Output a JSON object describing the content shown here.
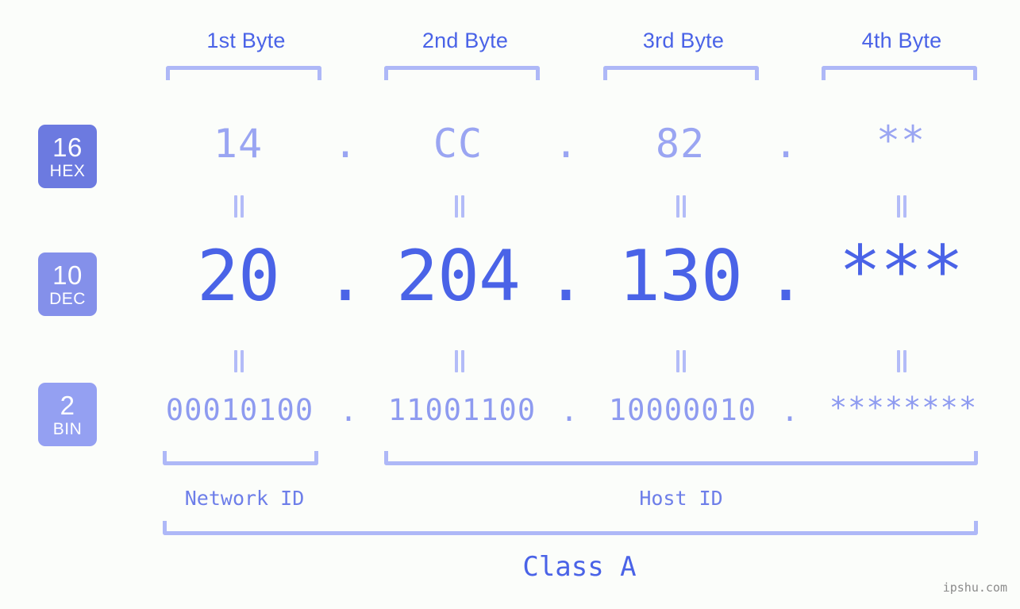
{
  "background_color": "#fbfdfa",
  "accent_colors": {
    "badge_hex": "#6c7ae0",
    "badge_dec": "#8490ea",
    "badge_bin": "#94a0f2",
    "value_hex": "#9aa5f2",
    "value_dec": "#4a63e7",
    "value_bin": "#8e9bf0",
    "bracket": "#aeb8f7",
    "header_label": "#4a63e7"
  },
  "header": {
    "byte_labels": [
      {
        "label": "1st Byte"
      },
      {
        "label": "2nd Byte"
      },
      {
        "label": "3rd Byte"
      },
      {
        "label": "4th Byte"
      }
    ]
  },
  "bases": [
    {
      "id": "hex",
      "number": "16",
      "name": "HEX"
    },
    {
      "id": "dec",
      "number": "10",
      "name": "DEC"
    },
    {
      "id": "bin",
      "number": "2",
      "name": "BIN"
    }
  ],
  "rows": {
    "hex": {
      "base_number": "16",
      "base_name": "HEX",
      "octets": [
        "14",
        "CC",
        "82",
        "**"
      ],
      "separators": [
        ".",
        ".",
        "."
      ]
    },
    "dec": {
      "base_number": "10",
      "base_name": "DEC",
      "octets": [
        "20",
        "204",
        "130",
        "***"
      ],
      "separators": [
        ".",
        ".",
        "."
      ]
    },
    "bin": {
      "base_number": "2",
      "base_name": "BIN",
      "octets": [
        "00010100",
        "11001100",
        "10000010",
        "********"
      ],
      "separators": [
        ".",
        ".",
        "."
      ]
    }
  },
  "equality_marks": {
    "glyph": "||",
    "count_per_row": 4,
    "rows": 2
  },
  "footer": {
    "network_id_label": "Network ID",
    "host_id_label": "Host ID",
    "class_label": "Class A"
  },
  "watermark": {
    "text": "ipshu.com"
  }
}
